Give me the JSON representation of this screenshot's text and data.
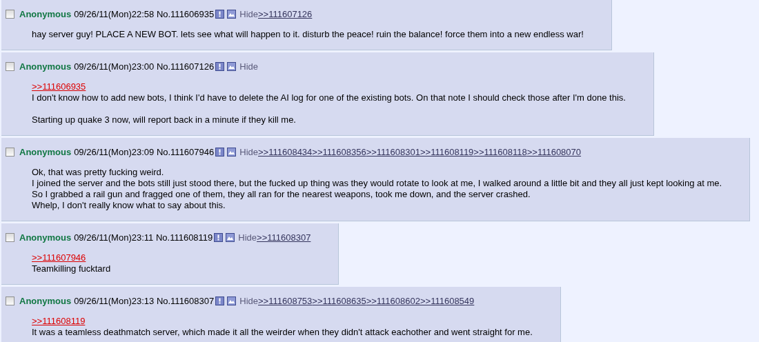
{
  "posts": [
    {
      "checked": false,
      "name": "Anonymous",
      "datetime": "09/26/11(Mon)22:58",
      "number": "No.111606935",
      "hide": "Hide",
      "backlinks": [
        ">>111607126"
      ],
      "body": [
        {
          "kind": "text",
          "text": "hay server guy! PLACE A NEW BOT. lets see what will happen to it. disturb the peace! ruin the balance! force them into a new endless war!"
        }
      ]
    },
    {
      "checked": false,
      "name": "Anonymous",
      "datetime": "09/26/11(Mon)23:00",
      "number": "No.111607126",
      "hide": "Hide",
      "body": [
        {
          "kind": "quote",
          "text": ">>111606935"
        },
        {
          "kind": "text",
          "text": "I don't know how to add new bots, I think I'd have to delete the AI log for one of the existing bots. On that note I should check those after I'm done this."
        },
        {
          "kind": "gap"
        },
        {
          "kind": "text",
          "text": "Starting up quake 3 now, will report back in a minute if they kill me."
        }
      ]
    },
    {
      "checked": false,
      "name": "Anonymous",
      "datetime": "09/26/11(Mon)23:09",
      "number": "No.111607946",
      "hide": "Hide",
      "backlinks": [
        ">>111608434",
        ">>111608356",
        ">>111608301",
        ">>111608119",
        ">>111608118",
        ">>111608070"
      ],
      "body": [
        {
          "kind": "text",
          "text": "Ok, that was pretty fucking weird."
        },
        {
          "kind": "text",
          "text": "I joined the server and the bots still just stood there, but the fucked up thing was they would rotate to look at me, I walked around a little bit and they all just kept looking at me."
        },
        {
          "kind": "text",
          "text": "So I grabbed a rail gun and fragged one of them, they all ran for the nearest weapons, took me down, and the server crashed."
        },
        {
          "kind": "text",
          "text": "Whelp, I don't really know what to say about this."
        }
      ]
    },
    {
      "checked": false,
      "name": "Anonymous",
      "datetime": "09/26/11(Mon)23:11",
      "number": "No.111608119",
      "hide": "Hide",
      "backlinks": [
        ">>111608307"
      ],
      "body": [
        {
          "kind": "quote",
          "text": ">>111607946"
        },
        {
          "kind": "text",
          "text": "Teamkilling fucktard"
        }
      ]
    },
    {
      "checked": false,
      "name": "Anonymous",
      "datetime": "09/26/11(Mon)23:13",
      "number": "No.111608307",
      "hide": "Hide",
      "backlinks": [
        ">>111608753",
        ">>111608635",
        ">>111608602",
        ">>111608549"
      ],
      "body": [
        {
          "kind": "quote",
          "text": ">>111608119"
        },
        {
          "kind": "text",
          "text": "It was a teamless deathmatch server, which made it all the weirder when they didn't attack eachother and went straight for me."
        }
      ]
    }
  ]
}
